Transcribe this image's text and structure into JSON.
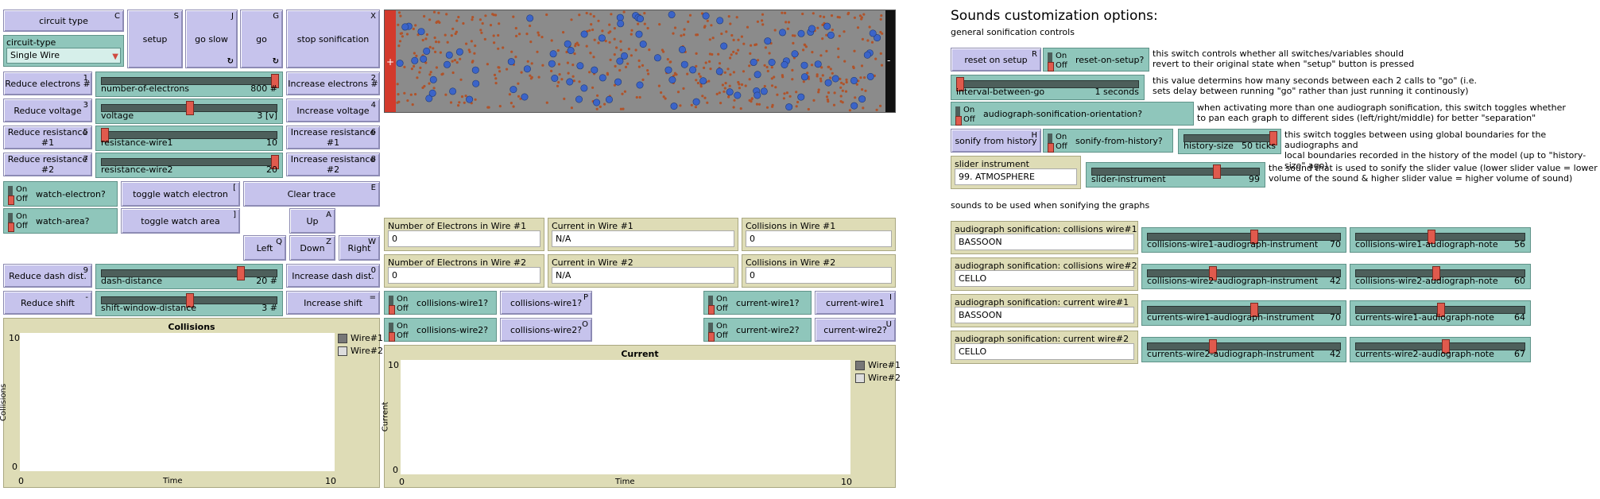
{
  "left": {
    "circuit_type_button": {
      "label": "circuit type",
      "key": "C"
    },
    "circuit_type_chooser": {
      "label": "circuit-type",
      "value": "Single Wire"
    },
    "setup": {
      "label": "setup",
      "key": "S"
    },
    "go_slow": {
      "label": "go slow",
      "key": "J"
    },
    "go": {
      "label": "go",
      "key": "G"
    },
    "stop_sonification": {
      "label": "stop sonification",
      "key": "X"
    },
    "reduce_electrons": {
      "label": "Reduce electrons #",
      "key": "1"
    },
    "number_of_electrons": {
      "label": "number-of-electrons",
      "value": "800 #",
      "level": 1.0
    },
    "increase_electrons": {
      "label": "Increase electrons #",
      "key": "2"
    },
    "reduce_voltage": {
      "label": "Reduce voltage",
      "key": "3"
    },
    "voltage": {
      "label": "voltage",
      "value": "3 [v]",
      "level": 0.5
    },
    "increase_voltage": {
      "label": "Increase voltage",
      "key": "4"
    },
    "reduce_resistance1": {
      "label": "Reduce resistance #1",
      "key": "5"
    },
    "resistance_wire1": {
      "label": "resistance-wire1",
      "value": "10",
      "level": 0.0
    },
    "increase_resistance1": {
      "label": "Increase resistance #1",
      "key": "6"
    },
    "reduce_resistance2": {
      "label": "Reduce resistance #2",
      "key": "7"
    },
    "resistance_wire2": {
      "label": "resistance-wire2",
      "value": "20",
      "level": 1.0
    },
    "increase_resistance2": {
      "label": "Increase resistance #2",
      "key": "8"
    },
    "watch_electron": {
      "label": "watch-electron?",
      "on": "On",
      "off": "Off"
    },
    "toggle_watch_electron": {
      "label": "toggle watch electron",
      "key": "["
    },
    "clear_trace": {
      "label": "Clear trace",
      "key": "E"
    },
    "watch_area": {
      "label": "watch-area?",
      "on": "On",
      "off": "Off"
    },
    "toggle_watch_area": {
      "label": "toggle watch area",
      "key": "]"
    },
    "up": {
      "label": "Up",
      "key": "A"
    },
    "left": {
      "label": "Left",
      "key": "Q"
    },
    "down": {
      "label": "Down",
      "key": "Z"
    },
    "right": {
      "label": "Right",
      "key": "W"
    },
    "reduce_dash": {
      "label": "Reduce dash dist.",
      "key": "9"
    },
    "dash_distance": {
      "label": "dash-distance",
      "value": "20 #",
      "level": 0.8
    },
    "increase_dash": {
      "label": "Increase dash dist.",
      "key": "0"
    },
    "reduce_shift": {
      "label": "Reduce shift",
      "key": "-"
    },
    "shift_window": {
      "label": "shift-window-distance",
      "value": "3 #",
      "level": 0.5
    },
    "increase_shift": {
      "label": "Increase shift",
      "key": "="
    }
  },
  "monitors": {
    "n_wire1": {
      "label": "Number of Electrons in Wire #1",
      "value": "0"
    },
    "current_wire1": {
      "label": "Current in Wire #1",
      "value": "N/A"
    },
    "collisions_wire1": {
      "label": "Collisions in Wire #1",
      "value": "0"
    },
    "n_wire2": {
      "label": "Number of Electrons in Wire #2",
      "value": "0"
    },
    "current_wire2": {
      "label": "Current in Wire #2",
      "value": "N/A"
    },
    "collisions_wire2": {
      "label": "Collisions in Wire #2",
      "value": "0"
    }
  },
  "mid": {
    "collisions_wire1_switch": {
      "label": "collisions-wire1?",
      "on": "On",
      "off": "Off"
    },
    "collisions_wire1_button": {
      "label": "collisions-wire1?",
      "key": "P"
    },
    "collisions_wire2_switch": {
      "label": "collisions-wire2?",
      "on": "On",
      "off": "Off"
    },
    "collisions_wire2_button": {
      "label": "collisions-wire2?",
      "key": "O"
    },
    "current_wire1_switch": {
      "label": "current-wire1?",
      "on": "On",
      "off": "Off"
    },
    "current_wire1_button": {
      "label": "current-wire1",
      "key": "I"
    },
    "current_wire2_switch": {
      "label": "current-wire2?",
      "on": "On",
      "off": "Off"
    },
    "current_wire2_button": {
      "label": "current-wire2?",
      "key": "U"
    }
  },
  "plots": {
    "collisions": {
      "title": "Collisions",
      "ylabel": "Collisions",
      "xlabel": "Time",
      "xmin": "0",
      "xmax": "10",
      "ymin": "0",
      "ymax": "10",
      "legend": [
        {
          "name": "Wire#1",
          "color": "#777777"
        },
        {
          "name": "Wire#2",
          "color": "#dddddd"
        }
      ]
    },
    "current": {
      "title": "Current",
      "ylabel": "Current",
      "xlabel": "Time",
      "xmin": "0",
      "xmax": "10",
      "ymin": "0",
      "ymax": "10",
      "legend": [
        {
          "name": "Wire#1",
          "color": "#777777"
        },
        {
          "name": "Wire#2",
          "color": "#dddddd"
        }
      ]
    }
  },
  "sound": {
    "heading": "Sounds customization options:",
    "subheading": "general sonification controls",
    "reset_on_setup": {
      "label": "reset on setup",
      "key": "R"
    },
    "reset_on_setup_switch": {
      "label": "reset-on-setup?",
      "on": "On",
      "off": "Off"
    },
    "note_reset": "whether all switches/variables should\nrevert to their original state when \"setup\" button is pressed",
    "note_reset_prefix": "this switch controls",
    "interval": {
      "label": "interval-between-go",
      "value": "1 seconds",
      "level": 0.0
    },
    "note_interval": "this value determins how many seconds between each 2 calls to \"go\" (i.e.\nsets delay between running \"go\" rather than just running it continously)",
    "orientation_switch": {
      "label": "audiograph-sonification-orientation?",
      "on": "On",
      "off": "Off"
    },
    "note_orientation": "when activating more than one audiograph sonification, this switch toggles whether\nto pan each graph to different sides (left/right/middle) for better \"separation\"",
    "sonify_history": {
      "label": "sonify from history",
      "key": "H"
    },
    "sonify_history_switch": {
      "label": "sonify-from-history?",
      "on": "On",
      "off": "Off"
    },
    "history_size": {
      "label": "history-size",
      "value": "50 ticks",
      "level": 1.0
    },
    "note_history": "this switch toggles between using global boundaries for the audiographs and\nlocal boundaries recorded in the history of the model (up to \"history-size\" ago)",
    "slider_instrument_chooser": {
      "label": "slider instrument",
      "value": "99. ATMOSPHERE"
    },
    "slider_instrument": {
      "label": "slider-instrument",
      "value": "99",
      "level": 0.75
    },
    "note_slider": "the sound that is used to sonify the slider value (lower slider value = lower\nvolume of the sound & higher slider value = higher volume of sound)",
    "graphs_heading": "sounds to be used when sonifying the graphs",
    "rows": [
      {
        "chooser_label": "audiograph sonification: collisions wire#1",
        "chooser_value": "BASSOON",
        "instr_label": "collisions-wire1-audiograph-instrument",
        "instr_value": "70",
        "instr_level": 0.55,
        "note_label": "collisions-wire1-audiograph-note",
        "note_value": "56",
        "note_level": 0.44
      },
      {
        "chooser_label": "audiograph sonification: collisions wire#2",
        "chooser_value": "CELLO",
        "instr_label": "collisions-wire2-audiograph-instrument",
        "instr_value": "42",
        "instr_level": 0.33,
        "note_label": "collisions-wire2-audiograph-note",
        "note_value": "60",
        "note_level": 0.47
      },
      {
        "chooser_label": "audiograph sonification: current wire#1",
        "chooser_value": "BASSOON",
        "instr_label": "currents-wire1-audiograph-instrument",
        "instr_value": "70",
        "instr_level": 0.55,
        "note_label": "currents-wire1-audiograph-note",
        "note_value": "64",
        "note_level": 0.5
      },
      {
        "chooser_label": "audiograph sonification: current wire#2",
        "chooser_value": "CELLO",
        "instr_label": "currents-wire2-audiograph-instrument",
        "instr_value": "42",
        "instr_level": 0.33,
        "note_label": "currents-wire2-audiograph-note",
        "note_value": "67",
        "note_level": 0.53
      }
    ]
  },
  "colors": {
    "button": "#c6c3ec",
    "slider": "#8fc6bb",
    "monitor": "#dedcb6",
    "electron_blue": "#3b64c8",
    "atom_brown": "#b0532a",
    "battery_red": "#d33a2c"
  }
}
